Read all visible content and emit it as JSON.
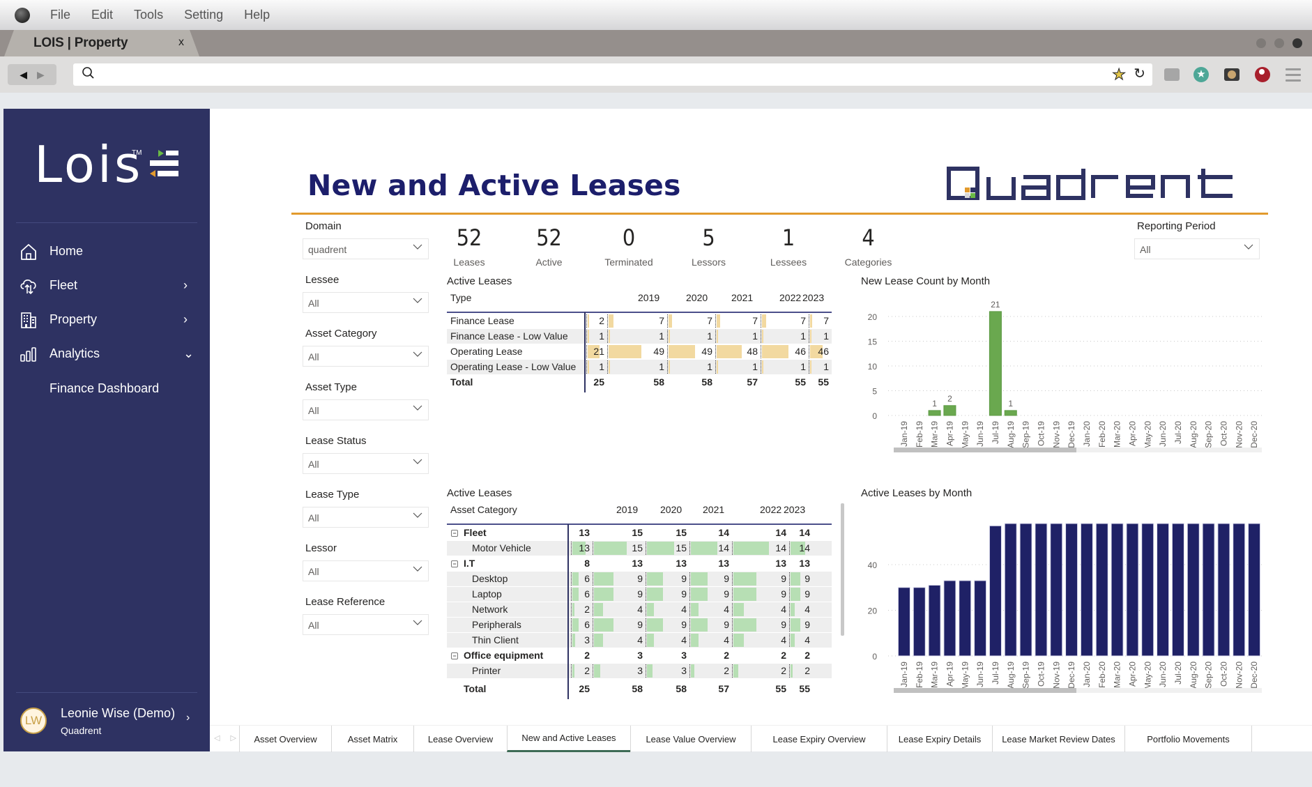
{
  "os_menu": {
    "items": [
      "File",
      "Edit",
      "Tools",
      "Setting",
      "Help"
    ]
  },
  "browser": {
    "tab_title": "LOIS | Property",
    "tab_close": "x",
    "url": "",
    "back": "◀",
    "forward": "▶"
  },
  "sidebar": {
    "logo_text": "Lois",
    "logo_tm": "TM",
    "nav": [
      {
        "label": "Home",
        "icon": "home-icon",
        "chevron": ""
      },
      {
        "label": "Fleet",
        "icon": "cloud-transfer-icon",
        "chevron": "›"
      },
      {
        "label": "Property",
        "icon": "building-icon",
        "chevron": "›"
      },
      {
        "label": "Analytics",
        "icon": "bar-chart-icon",
        "chevron": "⌄"
      }
    ],
    "subnav": [
      {
        "label": "Finance Dashboard"
      }
    ],
    "user": {
      "initials": "LW",
      "name": "Leonie Wise (Demo)",
      "org": "Quadrent",
      "chevron": "›"
    }
  },
  "report": {
    "title": "New and Active Leases",
    "brand_logo": "Quadrent",
    "colors": {
      "navy": "#1c1e6b",
      "accent_orange": "#e29a2d",
      "new_bar_green": "#6aa84f",
      "active_bar_navy": "#1f2166",
      "type_bar_tan": "#f2d9a0",
      "category_bar_green": "#b7dfb4"
    },
    "filters": [
      {
        "label": "Domain",
        "value": "quadrent"
      },
      {
        "label": "Lessee",
        "value": "All"
      },
      {
        "label": "Asset Category",
        "value": "All"
      },
      {
        "label": "Asset Type",
        "value": "All"
      },
      {
        "label": "Lease Status",
        "value": "All"
      },
      {
        "label": "Lease Type",
        "value": "All"
      },
      {
        "label": "Lessor",
        "value": "All"
      },
      {
        "label": "Lease Reference",
        "value": "All"
      }
    ],
    "reporting_period": {
      "label": "Reporting Period",
      "value": "All"
    },
    "kpis": [
      {
        "value": "52",
        "label": "Leases"
      },
      {
        "value": "52",
        "label": "Active"
      },
      {
        "value": "0",
        "label": "Terminated"
      },
      {
        "value": "5",
        "label": "Lessors"
      },
      {
        "value": "1",
        "label": "Lessees"
      },
      {
        "value": "4",
        "label": "Categories"
      }
    ],
    "matrix_type": {
      "title": "Active Leases",
      "row_header": "Type",
      "columns": [
        "",
        "2019",
        "2020",
        "2021",
        "2022",
        "2023"
      ],
      "rows": [
        {
          "label": "Finance Lease",
          "values": [
            2,
            7,
            7,
            7,
            7,
            7
          ]
        },
        {
          "label": "Finance Lease - Low Value",
          "values": [
            1,
            1,
            1,
            1,
            1,
            1
          ]
        },
        {
          "label": "Operating Lease",
          "values": [
            21,
            49,
            49,
            48,
            46,
            46
          ]
        },
        {
          "label": "Operating Lease - Low Value",
          "values": [
            1,
            1,
            1,
            1,
            1,
            1
          ]
        }
      ],
      "total": {
        "label": "Total",
        "values": [
          25,
          58,
          58,
          57,
          55,
          55
        ]
      }
    },
    "matrix_category": {
      "title": "Active Leases",
      "row_header": "Asset Category",
      "columns": [
        "",
        "2019",
        "2020",
        "2021",
        "2022",
        "2023"
      ],
      "rows": [
        {
          "label": "Fleet",
          "level": 0,
          "expander": "⊟",
          "values": [
            13,
            15,
            15,
            14,
            14,
            14
          ]
        },
        {
          "label": "Motor Vehicle",
          "level": 1,
          "values": [
            13,
            15,
            15,
            14,
            14,
            14
          ]
        },
        {
          "label": "I.T",
          "level": 0,
          "expander": "⊟",
          "values": [
            8,
            13,
            13,
            13,
            13,
            13
          ]
        },
        {
          "label": "Desktop",
          "level": 1,
          "values": [
            6,
            9,
            9,
            9,
            9,
            9
          ]
        },
        {
          "label": "Laptop",
          "level": 1,
          "values": [
            6,
            9,
            9,
            9,
            9,
            9
          ]
        },
        {
          "label": "Network",
          "level": 1,
          "values": [
            2,
            4,
            4,
            4,
            4,
            4
          ]
        },
        {
          "label": "Peripherals",
          "level": 1,
          "values": [
            6,
            9,
            9,
            9,
            9,
            9
          ]
        },
        {
          "label": "Thin Client",
          "level": 1,
          "values": [
            3,
            4,
            4,
            4,
            4,
            4
          ]
        },
        {
          "label": "Office equipment",
          "level": 0,
          "expander": "⊟",
          "values": [
            2,
            3,
            3,
            2,
            2,
            2
          ]
        },
        {
          "label": "Printer",
          "level": 1,
          "values": [
            2,
            3,
            3,
            2,
            2,
            2
          ]
        }
      ],
      "total": {
        "label": "Total",
        "values": [
          25,
          58,
          58,
          57,
          55,
          55
        ]
      }
    }
  },
  "chart_data": [
    {
      "type": "bar",
      "title": "New Lease Count by Month",
      "categories": [
        "Jan-19",
        "Feb-19",
        "Mar-19",
        "Apr-19",
        "May-19",
        "Jun-19",
        "Jul-19",
        "Aug-19",
        "Sep-19",
        "Oct-19",
        "Nov-19",
        "Dec-19",
        "Jan-20",
        "Feb-20",
        "Mar-20",
        "Apr-20",
        "May-20",
        "Jun-20",
        "Jul-20",
        "Aug-20",
        "Sep-20",
        "Oct-20",
        "Nov-20",
        "Dec-20"
      ],
      "values": [
        0,
        0,
        1,
        2,
        0,
        0,
        21,
        1,
        0,
        0,
        0,
        0,
        0,
        0,
        0,
        0,
        0,
        0,
        0,
        0,
        0,
        0,
        0,
        0
      ],
      "data_labels": true,
      "yticks": [
        0,
        5,
        10,
        15,
        20
      ],
      "ylim": [
        0,
        21
      ],
      "xlabel": "",
      "ylabel": "",
      "grid": true,
      "color": "#6aa84f",
      "scroll_fraction": 0.5
    },
    {
      "type": "bar",
      "title": "Active Leases by Month",
      "categories": [
        "Jan-19",
        "Feb-19",
        "Mar-19",
        "Apr-19",
        "May-19",
        "Jun-19",
        "Jul-19",
        "Aug-19",
        "Sep-19",
        "Oct-19",
        "Nov-19",
        "Dec-19",
        "Jan-20",
        "Feb-20",
        "Mar-20",
        "Apr-20",
        "May-20",
        "Jun-20",
        "Jul-20",
        "Aug-20",
        "Sep-20",
        "Oct-20",
        "Nov-20",
        "Dec-20"
      ],
      "values": [
        30,
        30,
        31,
        33,
        33,
        33,
        57,
        58,
        58,
        58,
        58,
        58,
        58,
        58,
        58,
        58,
        58,
        58,
        58,
        58,
        58,
        58,
        58,
        58
      ],
      "data_labels": false,
      "yticks": [
        0,
        20,
        40
      ],
      "ylim": [
        0,
        58
      ],
      "xlabel": "",
      "ylabel": "",
      "grid": true,
      "color": "#1f2166",
      "scroll_fraction": 0.5
    }
  ],
  "page_tabs": [
    {
      "label": "Asset Overview",
      "active": false
    },
    {
      "label": "Asset Matrix",
      "active": false
    },
    {
      "label": "Lease Overview",
      "active": false
    },
    {
      "label": "New and Active Leases",
      "active": true
    },
    {
      "label": "Lease Value Overview",
      "active": false
    },
    {
      "label": "Lease Expiry Overview",
      "active": false
    },
    {
      "label": "Lease Expiry Details",
      "active": false
    },
    {
      "label": "Lease Market Review Dates",
      "active": false
    },
    {
      "label": "Portfolio Movements",
      "active": false
    }
  ],
  "page_tab_arrows": "◁ ▷"
}
